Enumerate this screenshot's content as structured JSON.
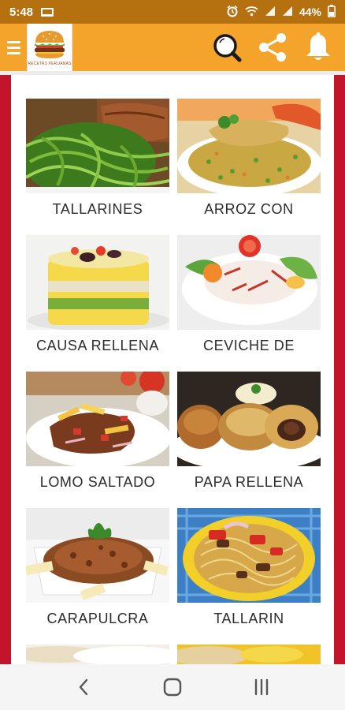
{
  "status_bar": {
    "time": "5:48",
    "battery": "44%",
    "icons": [
      "laptop-icon",
      "alarm-icon",
      "wifi-icon",
      "signal-icon",
      "signal-icon",
      "battery-icon"
    ]
  },
  "app_bar": {
    "logo_caption": "RECETAS PERUANAS",
    "icons": [
      "menu-icon",
      "burger-logo-icon",
      "search-icon",
      "share-icon",
      "bell-icon"
    ],
    "background": "#f4a32b"
  },
  "recipes": [
    {
      "title": "TALLARINES",
      "image": "green-noodles-with-steak"
    },
    {
      "title": "ARROZ CON",
      "image": "rice-with-chicken"
    },
    {
      "title": "CAUSA RELLENA",
      "image": "layered-potato-causa"
    },
    {
      "title": "CEVICHE DE",
      "image": "fish-ceviche"
    },
    {
      "title": "LOMO SALTADO",
      "image": "beef-stir-fry-with-fries"
    },
    {
      "title": "PAPA RELLENA",
      "image": "stuffed-potatoes"
    },
    {
      "title": "CARAPULCRA",
      "image": "dried-potato-stew"
    },
    {
      "title": "TALLARIN",
      "image": "stir-fried-noodles"
    }
  ],
  "nav_bar": {
    "icons": [
      "back-icon",
      "home-icon",
      "recents-icon"
    ]
  },
  "colors": {
    "status_bar": "#b5700f",
    "frame": "#c2152c",
    "title_text": "#2b2b2b"
  }
}
